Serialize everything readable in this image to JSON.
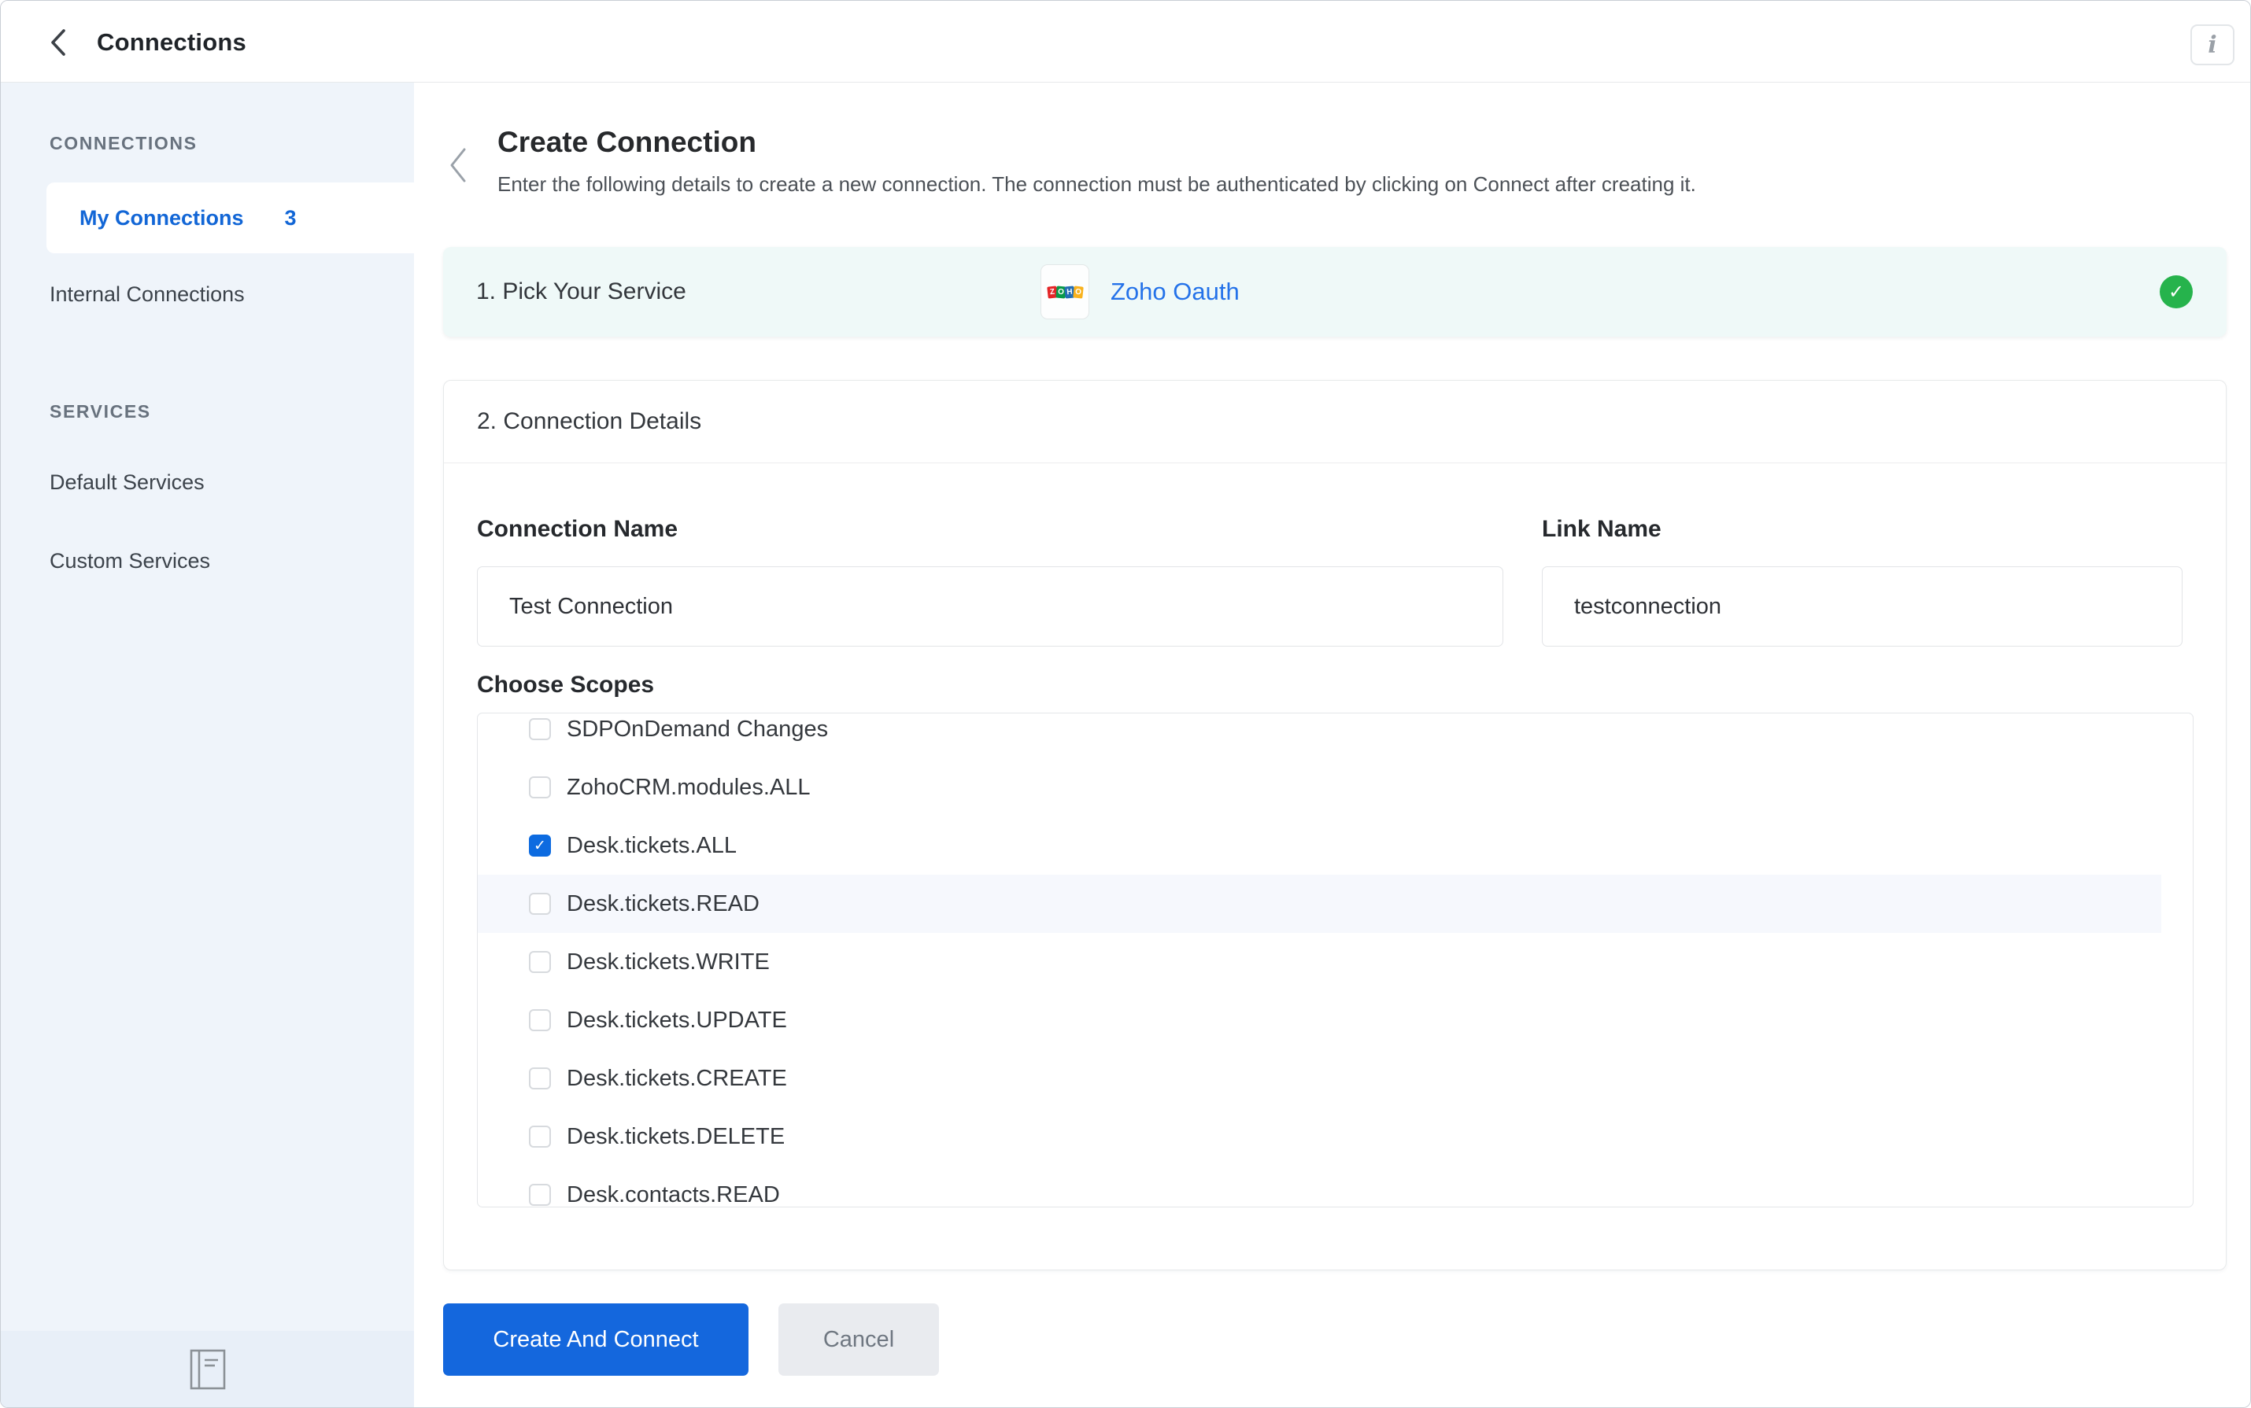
{
  "topbar": {
    "title": "Connections",
    "info_icon": "i"
  },
  "sidebar": {
    "sections": [
      {
        "title": "CONNECTIONS",
        "items": [
          {
            "label": "My Connections",
            "count": "3",
            "active": true
          },
          {
            "label": "Internal Connections",
            "active": false
          }
        ]
      },
      {
        "title": "SERVICES",
        "items": [
          {
            "label": "Default Services",
            "active": false
          },
          {
            "label": "Custom Services",
            "active": false
          }
        ]
      }
    ]
  },
  "main": {
    "title": "Create Connection",
    "subtitle": "Enter the following details to create a new connection. The connection must be authenticated by clicking on Connect after creating it.",
    "pick_service": {
      "step_label": "1. Pick Your Service",
      "service_name": "Zoho Oauth",
      "logo_letters": {
        "0": "Z",
        "1": "O",
        "2": "H",
        "3": "O"
      },
      "status": "completed",
      "status_color": "#26b34c"
    },
    "connection_details": {
      "step_label": "2. Connection Details",
      "connection_name": {
        "label": "Connection Name",
        "value": "Test Connection"
      },
      "link_name": {
        "label": "Link Name",
        "value": "testconnection"
      },
      "choose_scopes": {
        "label": "Choose Scopes",
        "items": [
          {
            "label": "SDPOnDemand Changes",
            "checked": false
          },
          {
            "label": "ZohoCRM.modules.ALL",
            "checked": false
          },
          {
            "label": "Desk.tickets.ALL",
            "checked": true
          },
          {
            "label": "Desk.tickets.READ",
            "checked": false,
            "highlighted": true
          },
          {
            "label": "Desk.tickets.WRITE",
            "checked": false
          },
          {
            "label": "Desk.tickets.UPDATE",
            "checked": false
          },
          {
            "label": "Desk.tickets.CREATE",
            "checked": false
          },
          {
            "label": "Desk.tickets.DELETE",
            "checked": false
          },
          {
            "label": "Desk.contacts.READ",
            "checked": false
          }
        ]
      }
    },
    "actions": {
      "primary": "Create And Connect",
      "secondary": "Cancel"
    }
  },
  "colors": {
    "accent_blue": "#1467dd",
    "link_blue": "#2472e9",
    "sidebar_active_blue": "#1266d6",
    "success_green": "#26b34c",
    "pick_card_bg": "#eff9f8",
    "sidebar_bg": "#eff4fa",
    "checkbox_checked": "#0d6be0",
    "scope_highlight": "#f6f8fd"
  }
}
